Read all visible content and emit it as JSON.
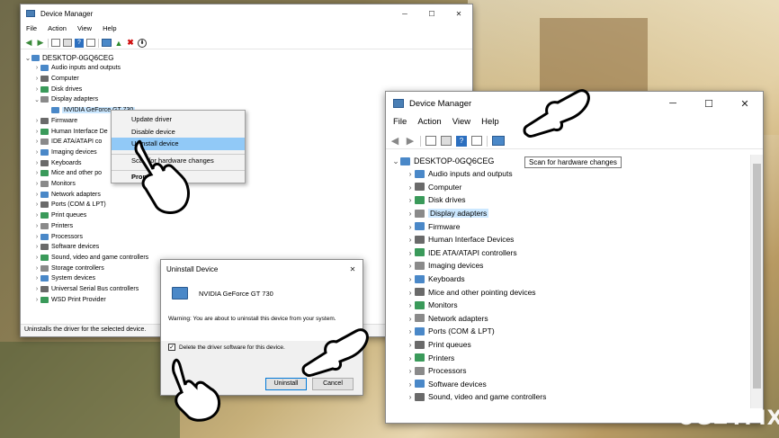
{
  "colors": {
    "selection": "#cce8ff",
    "menu_highlight": "#91c9f7",
    "accent": "#0078d7"
  },
  "left_window": {
    "title": "Device Manager",
    "window_buttons": [
      "─",
      "☐",
      "✕"
    ],
    "menu": [
      "File",
      "Action",
      "View",
      "Help"
    ],
    "root": "DESKTOP-0GQ6CEG",
    "items": [
      "Audio inputs and outputs",
      "Computer",
      "Disk drives",
      "Display adapters",
      "NVIDIA GeForce GT 730",
      "Firmware",
      "Human Interface De",
      "IDE ATA/ATAPI co",
      "Imaging devices",
      "Keyboards",
      "Mice and other po",
      "Monitors",
      "Network adapters",
      "Ports (COM & LPT)",
      "Print queues",
      "Printers",
      "Processors",
      "Software devices",
      "Sound, video and game controllers",
      "Storage controllers",
      "System devices",
      "Universal Serial Bus controllers",
      "WSD Print Provider"
    ],
    "status": "Uninstalls the driver for the selected device."
  },
  "context_menu": {
    "items": [
      "Update driver",
      "Disable device",
      "Uninstall device",
      "Scan for hardware changes",
      "Properties"
    ],
    "highlighted_index": 2
  },
  "dialog": {
    "title": "Uninstall Device",
    "device_name": "NVIDIA GeForce GT 730",
    "warning": "Warning: You are about to uninstall this device from your system.",
    "checkbox_label": "Delete the driver software for this device.",
    "checkbox_checked": true,
    "uninstall_label": "Uninstall",
    "cancel_label": "Cancel",
    "close_glyph": "✕"
  },
  "right_window": {
    "title": "Device Manager",
    "window_buttons": [
      "─",
      "☐",
      "✕"
    ],
    "menu": [
      "File",
      "Action",
      "View",
      "Help"
    ],
    "root": "DESKTOP-0GQ6CEG",
    "items": [
      "Audio inputs and outputs",
      "Computer",
      "Disk drives",
      "Display adapters",
      "Firmware",
      "Human Interface Devices",
      "IDE ATA/ATAPI controllers",
      "Imaging devices",
      "Keyboards",
      "Mice and other pointing devices",
      "Monitors",
      "Network adapters",
      "Ports (COM & LPT)",
      "Print queues",
      "Printers",
      "Processors",
      "Software devices",
      "Sound, video and game controllers"
    ],
    "selected_index": 3,
    "tooltip": "Scan for hardware changes"
  },
  "watermark": "UG≡TFIX"
}
